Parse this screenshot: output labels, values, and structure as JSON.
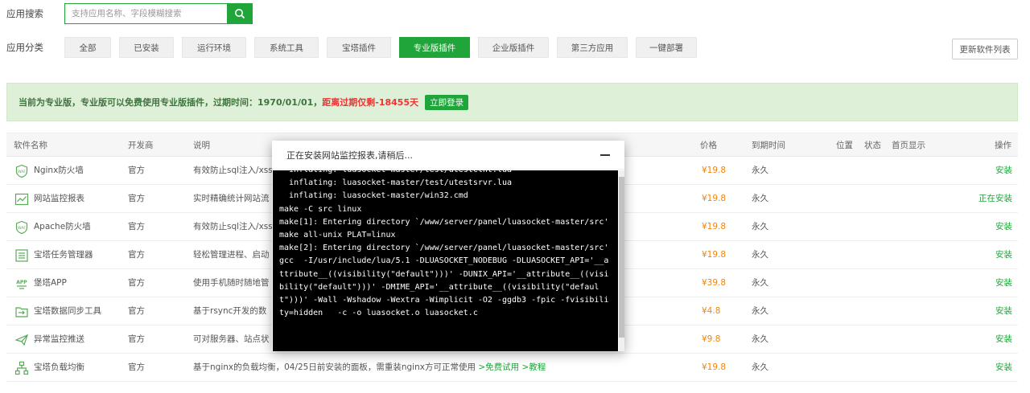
{
  "search": {
    "label": "应用搜索",
    "placeholder": "支持应用名称、字段模糊搜索"
  },
  "categories": {
    "label": "应用分类",
    "items": [
      "全部",
      "已安装",
      "运行环境",
      "系统工具",
      "宝塔插件",
      "专业版插件",
      "企业版插件",
      "第三方应用",
      "一键部署"
    ],
    "active_index": 5
  },
  "refresh_label": "更新软件列表",
  "notice": {
    "text": "当前为专业版，专业版可以免费使用专业版插件，过期时间：1970/01/01，",
    "remaining": "距离过期仅剩-18455天",
    "login": "立即登录"
  },
  "table": {
    "headers": {
      "name": "软件名称",
      "dev": "开发商",
      "desc": "说明",
      "price": "价格",
      "expire": "到期时间",
      "pos": "位置",
      "status": "状态",
      "home": "首页显示",
      "op": "操作"
    },
    "rows": [
      {
        "icon": "shield-icon",
        "name": "Nginx防火墙",
        "dev": "官方",
        "desc": "有效防止sql注入/xss",
        "price": "¥19.8",
        "expire": "永久",
        "op": "安装"
      },
      {
        "icon": "chart-icon",
        "name": "网站监控报表",
        "dev": "官方",
        "desc": "实时精确统计网站流",
        "price": "¥19.8",
        "expire": "永久",
        "op": "正在安装"
      },
      {
        "icon": "shield-icon",
        "name": "Apache防火墙",
        "dev": "官方",
        "desc": "有效防止sql注入/xss",
        "price": "¥19.8",
        "expire": "永久",
        "op": "安装"
      },
      {
        "icon": "list-icon",
        "name": "宝塔任务管理器",
        "dev": "官方",
        "desc": "轻松管理进程、启动",
        "price": "¥19.8",
        "expire": "永久",
        "op": "安装"
      },
      {
        "icon": "app-icon",
        "name": "堡塔APP",
        "dev": "官方",
        "desc": "使用手机随时随地管",
        "price": "¥39.8",
        "expire": "永久",
        "op": "安装"
      },
      {
        "icon": "sync-icon",
        "name": "宝塔数据同步工具",
        "dev": "官方",
        "desc": "基于rsync开发的数",
        "price": "¥4.8",
        "expire": "永久",
        "op": "安装"
      },
      {
        "icon": "mail-icon",
        "name": "异常监控推送",
        "dev": "官方",
        "desc": "可对服务器、站点状",
        "price": "¥9.8",
        "expire": "永久",
        "op": "安装"
      },
      {
        "icon": "network-icon",
        "name": "宝塔负载均衡",
        "dev": "官方",
        "desc": "基于nginx的负载均衡，04/25日前安装的面板，需重装nginx方可正常使用",
        "link1": ">免费试用",
        "link2": ">教程",
        "price": "¥19.8",
        "expire": "永久",
        "op": "安装"
      }
    ]
  },
  "modal": {
    "title": "正在安装网站监控报表,请稍后...",
    "lines": [
      "  inflating: luasocket-master/test/utestclnt.lua",
      "  inflating: luasocket-master/test/utestsrvr.lua",
      "  inflating: luasocket-master/win32.cmd",
      "make -C src linux",
      "make[1]: Entering directory `/www/server/panel/luasocket-master/src'",
      "make all-unix PLAT=linux",
      "make[2]: Entering directory `/www/server/panel/luasocket-master/src'",
      "gcc  -I/usr/include/lua/5.1 -DLUASOCKET_NODEBUG -DLUASOCKET_API='__attribute__((visibility(\"default\")))' -DUNIX_API='__attribute__((visibility(\"default\")))' -DMIME_API='__attribute__((visibility(\"default\")))' -Wall -Wshadow -Wextra -Wimplicit -O2 -ggdb3 -fpic -fvisibility=hidden   -c -o luasocket.o luasocket.c"
    ]
  }
}
